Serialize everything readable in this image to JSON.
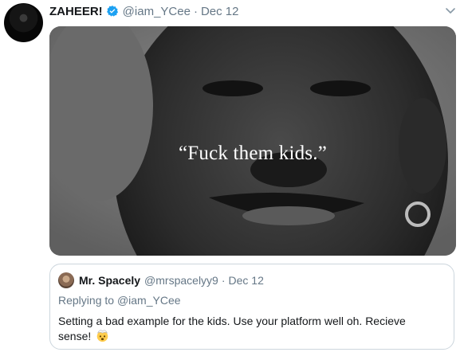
{
  "tweet": {
    "author_name": "ZAHEER!",
    "handle": "@iam_YCee",
    "separator": "·",
    "date": "Dec 12",
    "avatar_icon": "user-avatar",
    "verified_icon": "verified-badge-icon",
    "menu_icon": "chevron-down-icon",
    "media": {
      "caption": "“Fuck them kids.”"
    }
  },
  "quoted_tweet": {
    "author_name": "Mr. Spacely",
    "handle": "@mrspacelyy9",
    "separator": "·",
    "date": "Dec 12",
    "replying_label": "Replying to",
    "replying_to": "@iam_YCee",
    "text": "Setting a bad example for the kids. Use your platform well oh. Recieve sense!",
    "emoji_icon": "exploding-head-emoji"
  },
  "colors": {
    "verified_blue": "#1da1f2",
    "secondary_text": "#657786",
    "border": "#ccd6dd"
  }
}
